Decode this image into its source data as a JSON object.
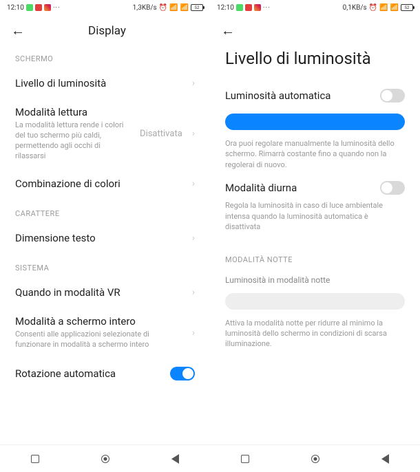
{
  "statusbar": {
    "time": "12:10",
    "net_speed_left": "1,3KB/s",
    "net_speed_right": "0,1KB/s",
    "battery": "52"
  },
  "left": {
    "header_title": "Display",
    "sections": {
      "schermo": {
        "label": "SCHERMO",
        "brightness": {
          "title": "Livello di luminosità"
        },
        "reading": {
          "title": "Modalità lettura",
          "sub": "La modalità lettura rende i colori del tuo schermo più caldi, permettendo agli occhi di rilassarsi",
          "value": "Disattivata"
        },
        "colors": {
          "title": "Combinazione di colori"
        }
      },
      "carattere": {
        "label": "CARATTERE",
        "textsize": {
          "title": "Dimensione testo"
        }
      },
      "sistema": {
        "label": "SISTEMA",
        "vr": {
          "title": "Quando in modalità VR"
        },
        "fullscreen": {
          "title": "Modalità a schermo intero",
          "sub": "Consenti alle applicazioni selezionate di funzionare in modalità a schermo intero"
        },
        "autorotate": {
          "title": "Rotazione automatica"
        }
      }
    }
  },
  "right": {
    "big_title": "Livello di luminosità",
    "auto_brightness": {
      "title": "Luminosità automatica"
    },
    "manual_note": "Ora puoi regolare manualmente la luminosità dello schermo. Rimarrà costante fino a quando non la regolerai di nuovo.",
    "day_mode": {
      "title": "Modalità diurna",
      "note": "Regola la luminosità in caso di luce ambientale intensa quando la luminosità automatica è disattivata"
    },
    "night": {
      "label": "MODALITÀ NOTTE",
      "slider_label": "Luminosità in modalità notte",
      "note": "Attiva la modalità notte per ridurre al minimo la luminosità dello schermo in condizioni di scarsa illuminazione."
    }
  }
}
